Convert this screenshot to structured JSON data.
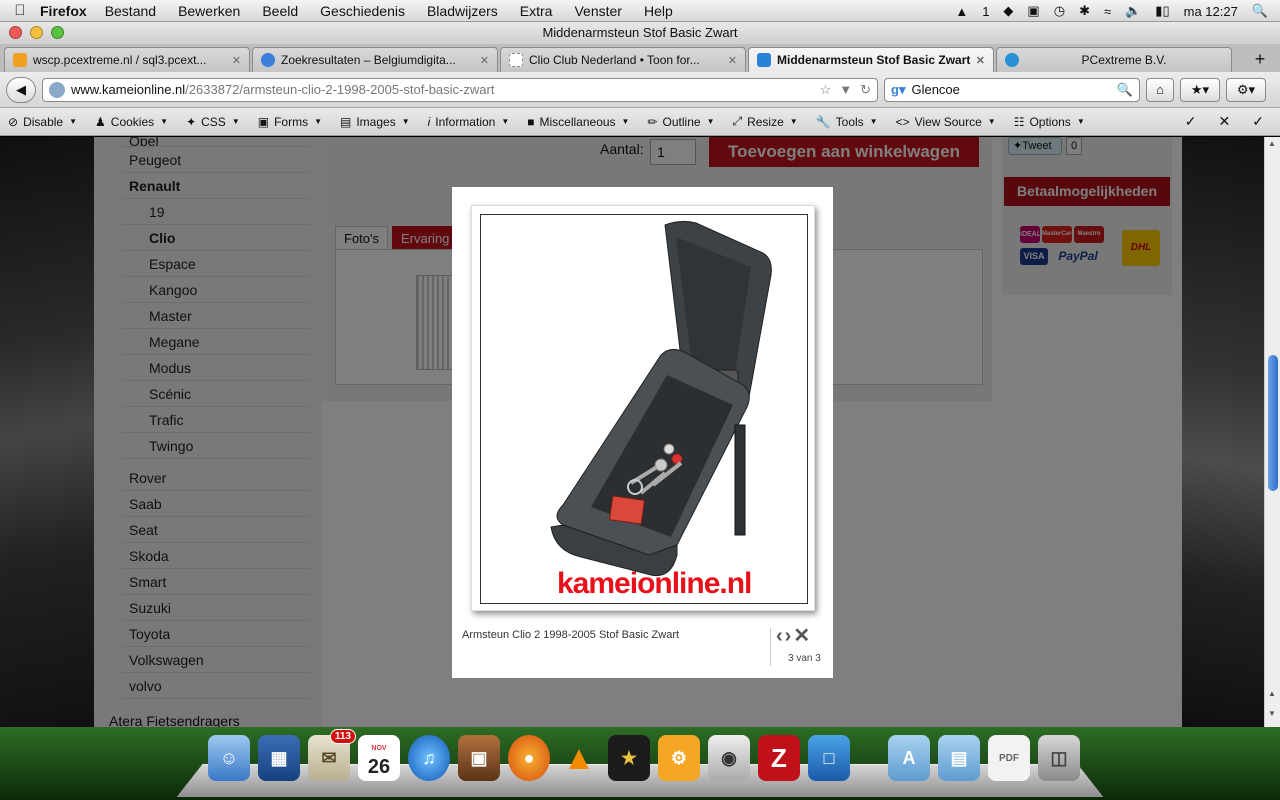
{
  "menubar": {
    "app": "Firefox",
    "items": [
      "Bestand",
      "Bewerken",
      "Beeld",
      "Geschiedenis",
      "Bladwijzers",
      "Extra",
      "Venster",
      "Help"
    ],
    "status_num": "1",
    "clock": "ma 12:27"
  },
  "window": {
    "title": "Middenarmsteun Stof Basic Zwart"
  },
  "tabs": [
    {
      "label": "wscp.pcextreme.nl / sql3.pcext...",
      "color": "#f0a020"
    },
    {
      "label": "Zoekresultaten – Belgiumdigita...",
      "color": "#3b7fd9"
    },
    {
      "label": "Clio Club Nederland • Toon for...",
      "color": "#cccccc"
    },
    {
      "label": "Middenarmsteun Stof Basic Zwart",
      "color": "#2a82d6"
    },
    {
      "label": "PCextreme B.V.",
      "color": "#2a8fd6"
    }
  ],
  "address": {
    "host": "www.kameionline.nl",
    "path": "/2633872/armsteun-clio-2-1998-2005-stof-basic-zwart"
  },
  "search": {
    "value": "Glencoe"
  },
  "devtoolbar": [
    "Disable",
    "Cookies",
    "CSS",
    "Forms",
    "Images",
    "Information",
    "Miscellaneous",
    "Outline",
    "Resize",
    "Tools",
    "View Source",
    "Options"
  ],
  "sidebar": {
    "brands_top": [
      "Opel",
      "Peugeot",
      "Renault"
    ],
    "renault_models": [
      "19",
      "Clio",
      "Espace",
      "Kangoo",
      "Master",
      "Megane",
      "Modus",
      "Scénic",
      "Trafic",
      "Twingo"
    ],
    "brands_bottom": [
      "Rover",
      "Saab",
      "Seat",
      "Skoda",
      "Smart",
      "Suzuki",
      "Toyota",
      "Volkswagen",
      "volvo"
    ],
    "section": "Atera Fietsendragers"
  },
  "product": {
    "qty_label": "Aantal:",
    "qty_value": "1",
    "add_to_cart": "Toevoegen aan winkelwagen",
    "tab_photos": "Foto's",
    "tab_reviews": "Ervaring"
  },
  "right": {
    "tweet": "Tweet",
    "tweet_count": "0",
    "payments_heading": "Betaalmogelijkheden",
    "payment_logos": [
      "iDEAL",
      "MasterCard",
      "Maestro",
      "VISA",
      "PayPal",
      "DHL"
    ]
  },
  "lightbox": {
    "watermark": "kameionline.nl",
    "caption": "Armsteun Clio 2 1998-2005 Stof Basic Zwart",
    "counter": "3 van 3"
  },
  "dock": {
    "mail_badge": "113",
    "calendar_month": "NOV",
    "calendar_day": "26"
  },
  "colors": {
    "cart_red": "#c2121c",
    "accent_blue": "#2f6fd0"
  }
}
